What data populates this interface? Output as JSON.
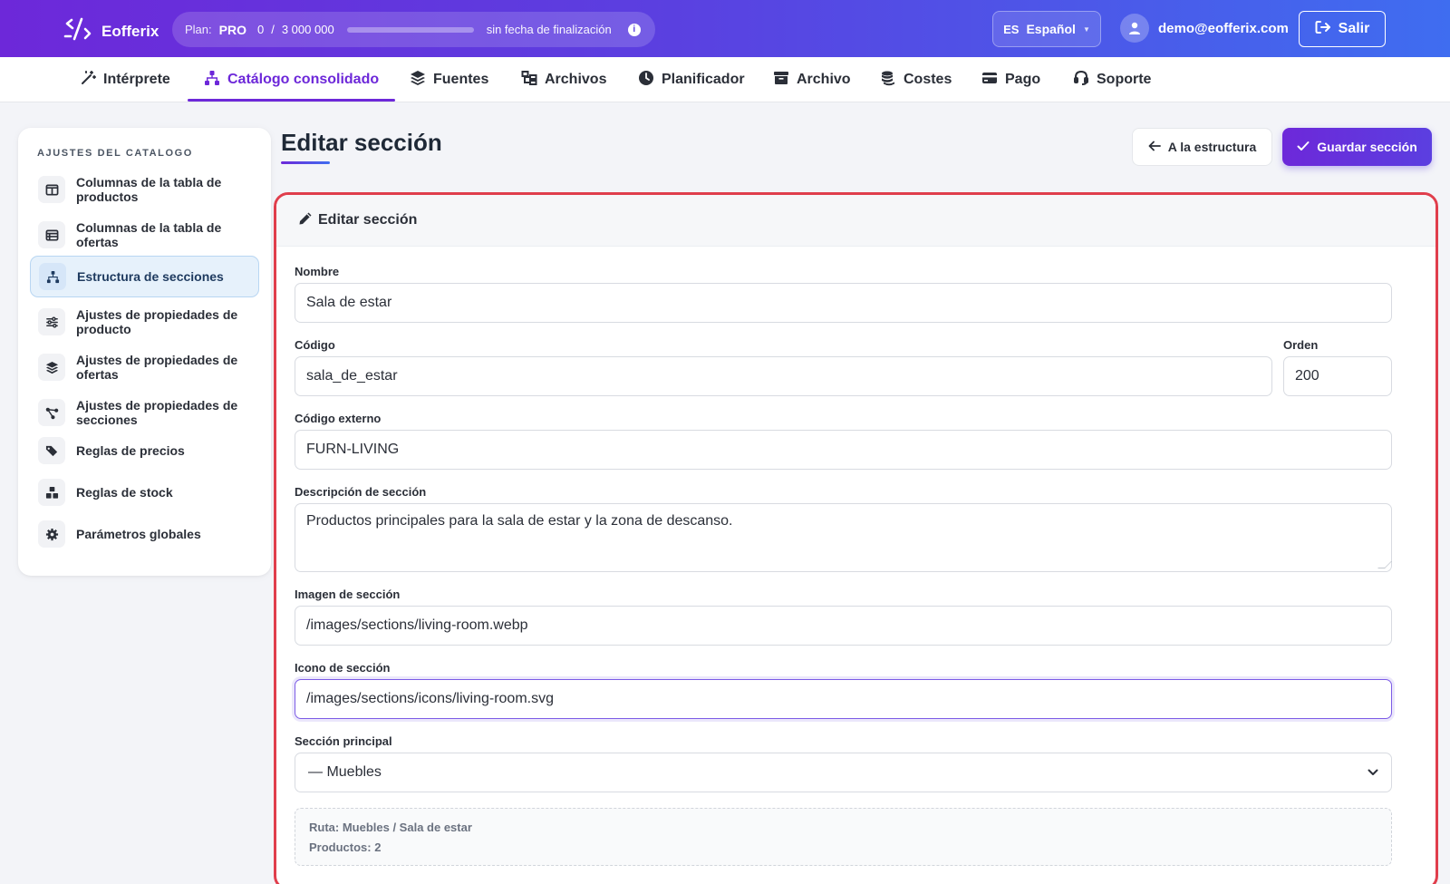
{
  "brand": {
    "name": "Eofferix"
  },
  "plan": {
    "label": "Plan:",
    "name": "PRO",
    "usage_used": "0",
    "usage_sep": "/",
    "usage_total": "3 000 000",
    "usage_fraction": 0,
    "expiry": "sin fecha de finalización",
    "info_icon": "info-icon"
  },
  "language": {
    "code": "ES",
    "label": "Español"
  },
  "user": {
    "email": "demo@eofferix.com"
  },
  "logout": {
    "label": "Salir"
  },
  "nav": {
    "items": [
      {
        "label": "Intérprete",
        "icon": "wand-icon"
      },
      {
        "label": "Catálogo consolidado",
        "icon": "sitemap-icon",
        "active": true
      },
      {
        "label": "Fuentes",
        "icon": "layers-icon"
      },
      {
        "label": "Archivos",
        "icon": "folder-tree-icon"
      },
      {
        "label": "Planificador",
        "icon": "clock-icon"
      },
      {
        "label": "Archivo",
        "icon": "archive-icon"
      },
      {
        "label": "Costes",
        "icon": "coins-icon"
      },
      {
        "label": "Pago",
        "icon": "credit-card-icon"
      },
      {
        "label": "Soporte",
        "icon": "headset-icon"
      }
    ]
  },
  "sidebar": {
    "title": "AJUSTES DEL CATALOGO",
    "items": [
      {
        "label": "Columnas de la tabla de productos",
        "icon": "table-columns-icon"
      },
      {
        "label": "Columnas de la tabla de ofertas",
        "icon": "table-list-icon"
      },
      {
        "label": "Estructura de secciones",
        "icon": "sitemap-icon",
        "active": true
      },
      {
        "label": "Ajustes de propiedades de producto",
        "icon": "sliders-icon"
      },
      {
        "label": "Ajustes de propiedades de ofertas",
        "icon": "layers-icon"
      },
      {
        "label": "Ajustes de propiedades de secciones",
        "icon": "share-nodes-icon"
      },
      {
        "label": "Reglas de precios",
        "icon": "tags-icon"
      },
      {
        "label": "Reglas de stock",
        "icon": "boxes-icon"
      },
      {
        "label": "Parámetros globales",
        "icon": "gear-icon"
      }
    ]
  },
  "page": {
    "title": "Editar sección",
    "back_label": "A la estructura",
    "save_label": "Guardar sección"
  },
  "form": {
    "header": "Editar sección",
    "name_label": "Nombre",
    "name_value": "Sala de estar",
    "code_label": "Código",
    "code_value": "sala_de_estar",
    "order_label": "Orden",
    "order_value": "200",
    "external_code_label": "Código externo",
    "external_code_value": "FURN-LIVING",
    "description_label": "Descripción de sección",
    "description_value": "Productos principales para la sala de estar y la zona de descanso.",
    "image_label": "Imagen de sección",
    "image_value": "/images/sections/living-room.webp",
    "icon_label": "Icono de sección",
    "icon_value": "/images/sections/icons/living-room.svg",
    "parent_label": "Sección principal",
    "parent_value": "— Muebles",
    "path_text": "Ruta: Muebles / Sala de estar",
    "products_text": "Productos: 2"
  },
  "colors": {
    "accent": "#6d28d9",
    "highlight_border": "#e03e4c",
    "active_sidebar": "#e6f1fb"
  }
}
